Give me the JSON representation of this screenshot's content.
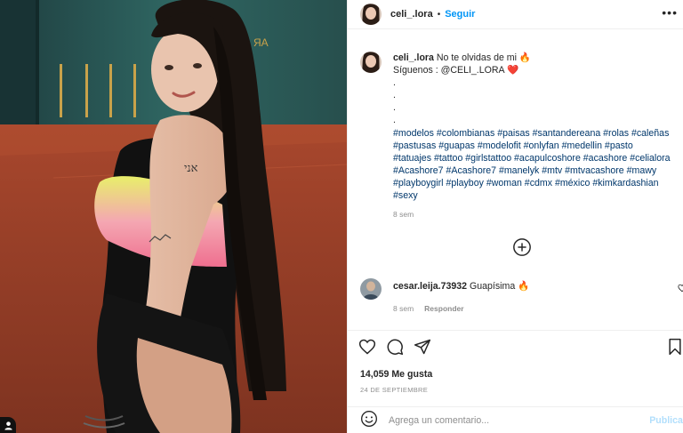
{
  "post": {
    "image_alt_icons": {
      "badge": "user-tag-icon"
    }
  },
  "header": {
    "username": "celi_.lora",
    "separator": "•",
    "follow_label": "Seguir",
    "more_icon": "more-horizontal-icon",
    "more_glyph": "•••"
  },
  "caption": {
    "username": "celi_.lora",
    "text_line1": " No te olvidas de mi 🔥",
    "text_line2": "Síguenos : @CELI_.LORA ❤️",
    "dots": [
      ".",
      ".",
      ".",
      "."
    ],
    "hashtags": "#modelos #colombianas #paisas #santandereana #rolas #caleñas #pastusas #guapas #modelofit #onlyfan #medellin #pasto #tatuajes #tattoo #girlstattoo #acapulcoshore #acashore #celialora #Acashore7 #Acashore7 #manelyk #mtv #mtvacashore #mawy #playboygirl #playboy #woman #cdmx #méxico #kimkardashian #sexy",
    "time": "8 sem"
  },
  "load_more_icon": "plus-circle-icon",
  "comment": {
    "username": "cesar.leija.73932",
    "text": " Guapísima 🔥",
    "time": "8 sem",
    "reply_label": "Responder",
    "heart_icon": "heart-icon"
  },
  "actions": {
    "like_icon": "heart-icon",
    "comment_icon": "comment-icon",
    "share_icon": "send-icon",
    "save_icon": "bookmark-icon",
    "likes": "14,059 Me gusta",
    "date": "24 DE SEPTIEMBRE"
  },
  "add_comment": {
    "emoji_icon": "emoji-icon",
    "placeholder": "Agrega un comentario...",
    "publish_label": "Publicar"
  },
  "colors": {
    "link": "#0095f6",
    "hashtag": "#00376b",
    "muted": "#8e8e8e",
    "publish_disabled": "#b2dffc"
  }
}
